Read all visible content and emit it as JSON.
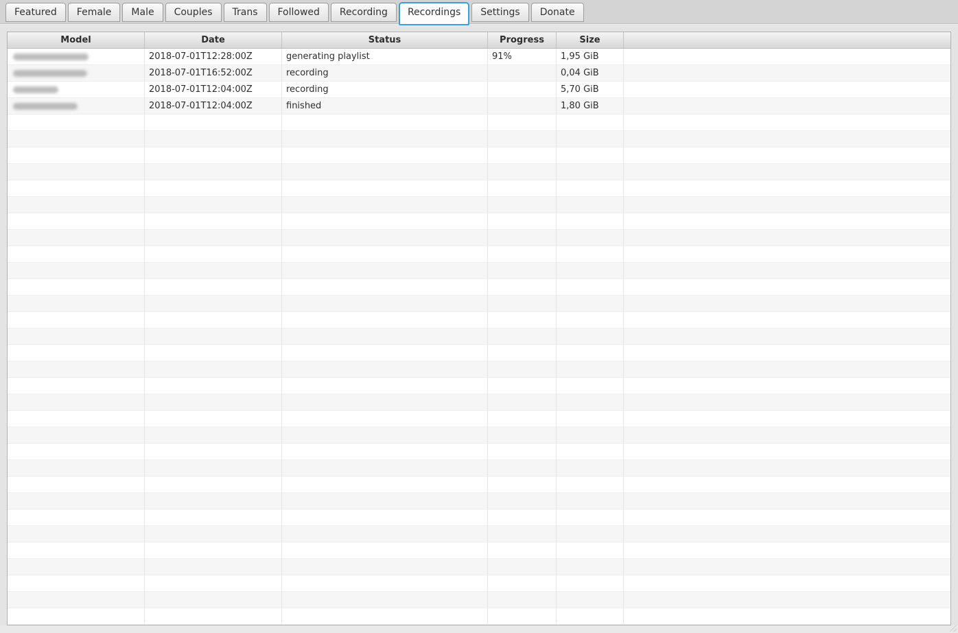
{
  "tabs": [
    {
      "label": "Featured",
      "active": false
    },
    {
      "label": "Female",
      "active": false
    },
    {
      "label": "Male",
      "active": false
    },
    {
      "label": "Couples",
      "active": false
    },
    {
      "label": "Trans",
      "active": false
    },
    {
      "label": "Followed",
      "active": false
    },
    {
      "label": "Recording",
      "active": false
    },
    {
      "label": "Recordings",
      "active": true
    },
    {
      "label": "Settings",
      "active": false
    },
    {
      "label": "Donate",
      "active": false
    }
  ],
  "table": {
    "columns": [
      "Model",
      "Date",
      "Status",
      "Progress",
      "Size"
    ],
    "rows": [
      {
        "model": "",
        "redact_width": 110,
        "date": "2018-07-01T12:28:00Z",
        "status": "generating playlist",
        "progress": "91%",
        "size": "1,95 GiB"
      },
      {
        "model": "",
        "redact_width": 108,
        "date": "2018-07-01T16:52:00Z",
        "status": "recording",
        "progress": "",
        "size": "0,04 GiB"
      },
      {
        "model": "",
        "redact_width": 66,
        "date": "2018-07-01T12:04:00Z",
        "status": "recording",
        "progress": "",
        "size": "5,70 GiB"
      },
      {
        "model": "",
        "redact_width": 94,
        "date": "2018-07-01T12:04:00Z",
        "status": "finished",
        "progress": "",
        "size": "1,80 GiB"
      }
    ],
    "empty_row_count": 31
  },
  "colors": {
    "accent": "#3d9fd8",
    "page_bg": "#e4e4e4",
    "tabband_bg": "#d4d4d4",
    "row_alt": "#f6f6f6",
    "table_border": "#b2b2b2",
    "text": "#2e2e2e"
  }
}
